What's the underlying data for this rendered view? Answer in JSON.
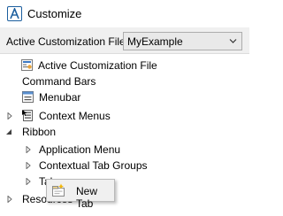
{
  "window": {
    "title": "Customize",
    "icon": "autocad-a-icon"
  },
  "customization_file": {
    "label": "Active Customization File",
    "selected": "MyExample"
  },
  "tree": {
    "items": [
      {
        "label": "Active Customization File",
        "icon": "cui-file-icon",
        "expander": "none"
      },
      {
        "label": "Command Bars",
        "icon": "none",
        "expander": "none"
      },
      {
        "label": "Menubar",
        "icon": "menubar-icon",
        "expander": "none"
      },
      {
        "label": "Context Menus",
        "icon": "context-menu-icon",
        "expander": "collapsed"
      },
      {
        "label": "Ribbon",
        "icon": "none",
        "expander": "expanded"
      },
      {
        "label": "Application Menu",
        "icon": "none",
        "expander": "collapsed"
      },
      {
        "label": "Contextual Tab Groups",
        "icon": "none",
        "expander": "collapsed"
      },
      {
        "label": "Tabs",
        "icon": "none",
        "expander": "collapsed"
      },
      {
        "label": "Resources",
        "icon": "none",
        "expander": "collapsed"
      }
    ]
  },
  "context_menu": {
    "items": [
      {
        "label": "New Tab",
        "icon": "new-tab-icon"
      }
    ]
  },
  "colors": {
    "accent": "#1b5e9e",
    "menu_background": "#f0f0f0"
  }
}
